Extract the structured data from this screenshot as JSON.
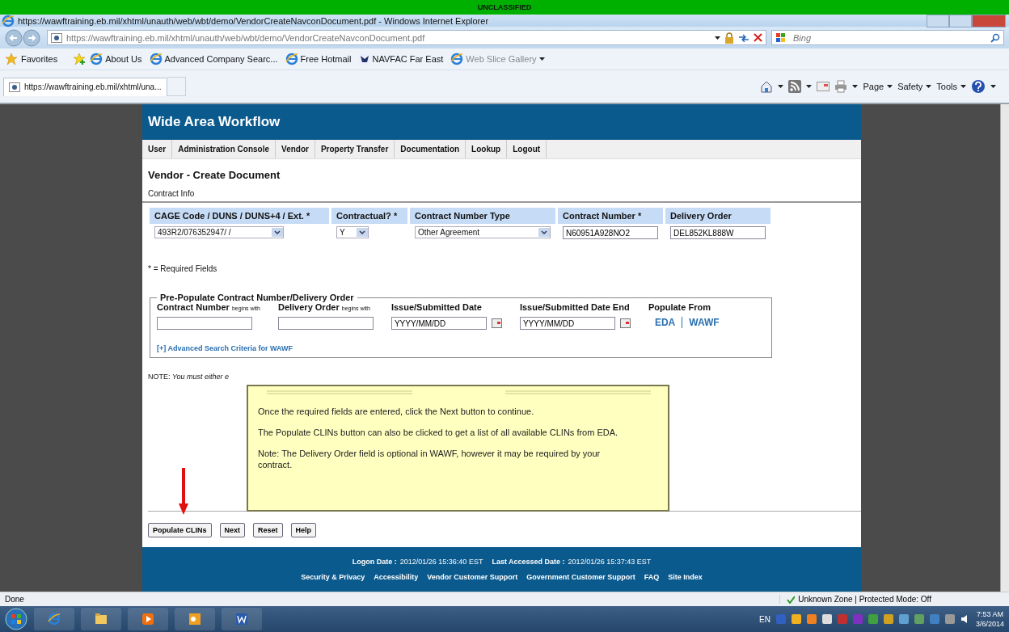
{
  "classification_banner": "UNCLASSIFIED",
  "window": {
    "title": "https://wawftraining.eb.mil/xhtml/unauth/web/wbt/demo/VendorCreateNavconDocument.pdf - Windows Internet Explorer"
  },
  "address_bar": {
    "url": "https://wawftraining.eb.mil/xhtml/unauth/web/wbt/demo/VendorCreateNavconDocument.pdf"
  },
  "search": {
    "placeholder": "Bing"
  },
  "favorites_bar": {
    "label": "Favorites",
    "items": [
      {
        "label": "About Us",
        "kind": "link"
      },
      {
        "label": "Advanced Company Searc...",
        "kind": "link"
      },
      {
        "label": "Free Hotmail",
        "kind": "link"
      },
      {
        "label": "NAVFAC Far East",
        "kind": "emblem"
      },
      {
        "label": "Web Slice Gallery",
        "kind": "menu"
      }
    ]
  },
  "tabs": [
    {
      "label": "https://wawftraining.eb.mil/xhtml/una...",
      "selected": true
    }
  ],
  "command_bar": [
    "Page",
    "Safety",
    "Tools"
  ],
  "page": {
    "app_title": "Wide Area Workflow",
    "menu": [
      "User",
      "Administration Console",
      "Vendor",
      "Property Transfer",
      "Documentation",
      "Lookup",
      "Logout"
    ],
    "heading": "Vendor - Create Document",
    "section": "Contract Info",
    "contract_fields": [
      {
        "label": "CAGE Code / DUNS / DUNS+4 / Ext. *",
        "kind": "select",
        "value": "493R2/076352947/ /"
      },
      {
        "label": "Contractual? *",
        "kind": "select",
        "value": "Y"
      },
      {
        "label": "Contract Number Type",
        "kind": "select",
        "value": "Other Agreement"
      },
      {
        "label": "Contract Number *",
        "kind": "text",
        "value": "N60951A928NO2"
      },
      {
        "label": "Delivery Order",
        "kind": "text",
        "value": "DEL852KL888W"
      }
    ],
    "required_note": "* = Required Fields",
    "prepopulate": {
      "legend": "Pre-Populate Contract Number/Delivery Order",
      "fields": [
        {
          "label": "Contract Number",
          "hint": "begins with",
          "kind": "text"
        },
        {
          "label": "Delivery Order",
          "hint": "begins with",
          "kind": "text"
        },
        {
          "label": "Issue/Submitted Date",
          "kind": "date",
          "value": "YYYY/MM/DD"
        },
        {
          "label": "Issue/Submitted Date End",
          "kind": "date",
          "value": "YYYY/MM/DD"
        }
      ],
      "populate_from": {
        "label": "Populate From",
        "links": [
          "EDA",
          "WAWF"
        ]
      },
      "advanced_link": "[+] Advanced Search Criteria for WAWF"
    },
    "note": "NOTE: *You must either e*",
    "buttons": [
      "Populate CLINs",
      "Next",
      "Reset",
      "Help"
    ]
  },
  "tooltip": {
    "paragraphs": [
      "Once the required fields are entered, click the Next button to continue.",
      "The Populate CLINs button can also be clicked to get a list of all available CLINs from EDA.",
      "Note: The Delivery Order field is optional in WAWF, however it may be required by your contract."
    ]
  },
  "footer": {
    "logon_label": "Logon Date :",
    "logon_value": "2012/01/26 15:36:40 EST",
    "accessed_label": "Last Accessed Date :",
    "accessed_value": "2012/01/26 15:37:43 EST",
    "links": [
      "Security & Privacy",
      "Accessibility",
      "Vendor Customer Support",
      "Government Customer Support",
      "FAQ",
      "Site Index"
    ]
  },
  "status_bar": {
    "text": "Done",
    "zone": "Unknown Zone | Protected Mode: Off"
  },
  "taskbar": {
    "language": "EN",
    "time": "7:53 AM",
    "date": "3/6/2014"
  }
}
